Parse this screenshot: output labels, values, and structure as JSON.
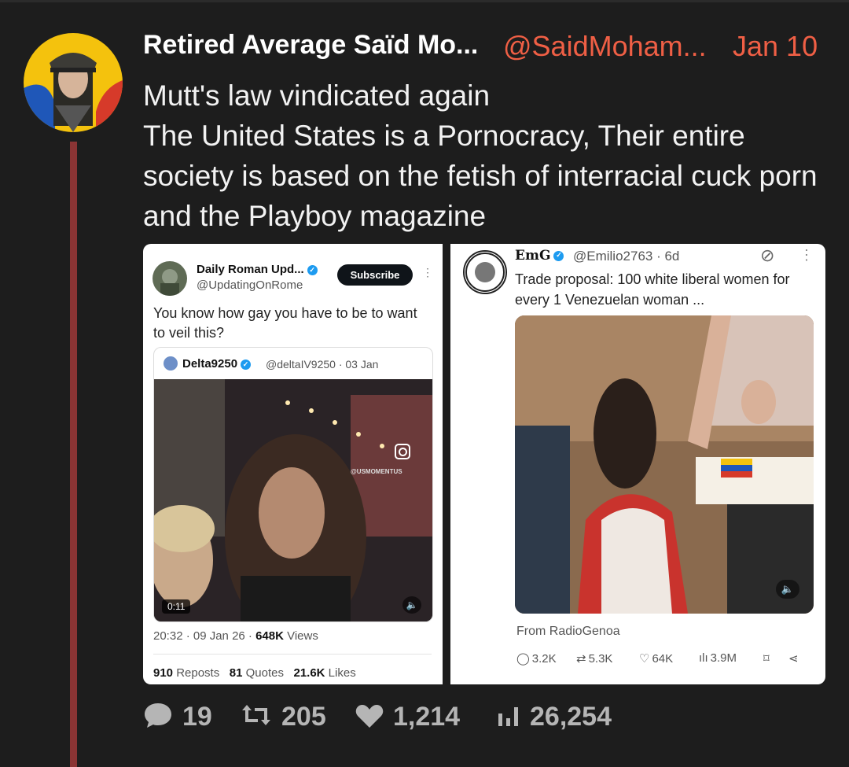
{
  "post": {
    "author_name": "Retired Average Saïd Mo...",
    "handle": "@SaidMoham...",
    "date": "Jan 10",
    "lines": [
      "Mutt's law vindicated again",
      "The United States is a Pornocracy, Their entire society is based on the fetish of interracial cuck porn and the Playboy magazine"
    ]
  },
  "left_tweet": {
    "author_name": "Daily Roman Upd...",
    "handle": "@UpdatingOnRome",
    "subscribe_label": "Subscribe",
    "text": "You know how gay you have to be to want to veil this?",
    "quote": {
      "author_name": "Delta9250",
      "handle_date": "@deltaIV9250 · 03 Jan",
      "watermark": "@USMOMENTUS",
      "duration": "0:11"
    },
    "meta_time": "20:32 · 09 Jan 26 · ",
    "meta_views_value": "648K",
    "meta_views_label": " Views",
    "reposts_value": "910",
    "reposts_label": " Reposts",
    "quotes_value": "81",
    "quotes_label": " Quotes",
    "likes_value": "21.6K",
    "likes_label": " Likes"
  },
  "right_tweet": {
    "author_name": "EmG",
    "handle_date": "@Emilio2763 · 6d",
    "text": "Trade proposal: 100 white liberal women for every 1 Venezuelan woman ...",
    "from": "From RadioGenoa",
    "replies": "3.2K",
    "reposts": "5.3K",
    "likes": "64K",
    "views": "3.9M"
  },
  "footer": {
    "replies": "19",
    "reposts": "205",
    "likes": "1,214",
    "views": "26,254"
  },
  "colors": {
    "background": "#1d1d1d",
    "accent": "#ef5f45",
    "thread_line": "#8a3434",
    "muted": "#b5b5b5"
  },
  "icons": [
    "reply-icon",
    "repost-icon",
    "like-icon",
    "views-icon",
    "verified-icon",
    "bookmark-icon",
    "share-icon",
    "volume-icon",
    "instagram-icon",
    "grok-icon",
    "more-icon"
  ]
}
